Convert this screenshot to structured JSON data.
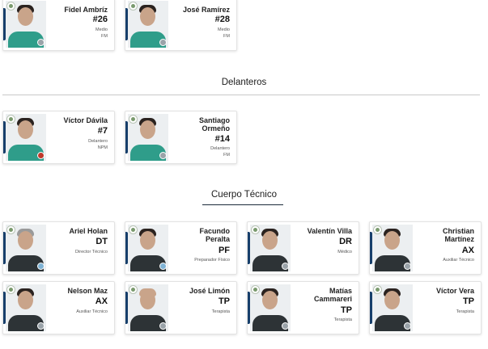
{
  "colors": {
    "jersey_green": "#2f9d8a",
    "jersey_dark": "#2d3336",
    "accent": "#173f6b"
  },
  "top_players": [
    {
      "name": "Fidel Ambríz",
      "number": "#26",
      "position": "Medio",
      "sub": "FM"
    },
    {
      "name": "José Ramírez",
      "number": "#28",
      "position": "Medio",
      "sub": "FM"
    }
  ],
  "sections": {
    "forwards": {
      "title": "Delanteros",
      "players": [
        {
          "name": "Víctor Dávila",
          "number": "#7",
          "position": "Delantero",
          "sub": "NPM"
        },
        {
          "name": "Santiago Ormeño",
          "number": "#14",
          "position": "Delantero",
          "sub": "FM"
        }
      ]
    },
    "staff": {
      "title": "Cuerpo Técnico",
      "members": [
        {
          "name": "Ariel Holan",
          "code": "DT",
          "role": "Director Técnico"
        },
        {
          "name": "Facundo Peralta",
          "code": "PF",
          "role": "Preparador Físico"
        },
        {
          "name": "Valentín Villa",
          "code": "DR",
          "role": "Médico"
        },
        {
          "name": "Christian Martínez",
          "code": "AX",
          "role": "Auxiliar Técnico"
        },
        {
          "name": "Nelson Maz",
          "code": "AX",
          "role": "Auxiliar Técnico"
        },
        {
          "name": "José Limón",
          "code": "TP",
          "role": "Terapista"
        },
        {
          "name": "Matías Cammareri",
          "code": "TP",
          "role": "Terapista"
        },
        {
          "name": "Víctor Vera",
          "code": "TP",
          "role": "Terapista"
        }
      ]
    }
  }
}
